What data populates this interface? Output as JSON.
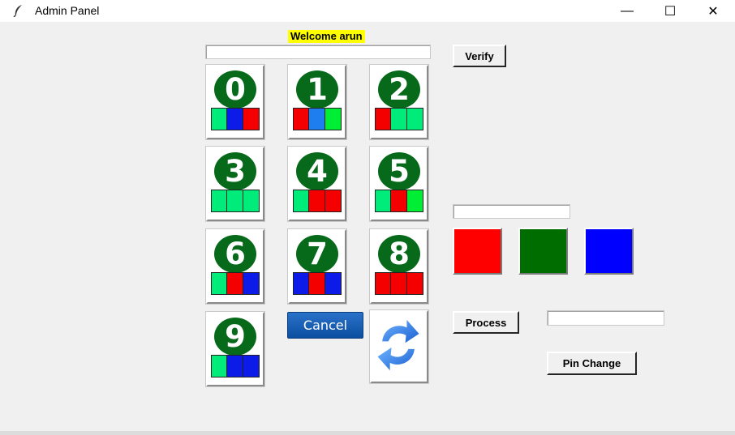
{
  "window": {
    "title": "Admin Panel",
    "icon": "feather-icon",
    "controls": {
      "minimize": "—",
      "maximize": "☐",
      "close": "✕"
    }
  },
  "welcome_text": "Welcome arun",
  "pin_entry_value": "",
  "verify_label": "Verify",
  "keys": [
    {
      "digit": "0",
      "colors": [
        "green",
        "blue",
        "red"
      ]
    },
    {
      "digit": "1",
      "colors": [
        "red",
        "lightblue",
        "lime"
      ]
    },
    {
      "digit": "2",
      "colors": [
        "red",
        "green",
        "green"
      ]
    },
    {
      "digit": "3",
      "colors": [
        "green",
        "green",
        "green"
      ]
    },
    {
      "digit": "4",
      "colors": [
        "green",
        "red",
        "red"
      ]
    },
    {
      "digit": "5",
      "colors": [
        "green",
        "red",
        "lime"
      ]
    },
    {
      "digit": "6",
      "colors": [
        "green",
        "red",
        "blue"
      ]
    },
    {
      "digit": "7",
      "colors": [
        "blue",
        "red",
        "blue"
      ]
    },
    {
      "digit": "8",
      "colors": [
        "red",
        "red",
        "red"
      ]
    },
    {
      "digit": "9",
      "colors": [
        "green",
        "blue",
        "blue"
      ]
    }
  ],
  "cancel_label": "Cancel",
  "refresh_icon": "refresh-icon",
  "color_entry_value": "",
  "swatches": [
    {
      "name": "red",
      "color": "#ff0000"
    },
    {
      "name": "green",
      "color": "#006d00"
    },
    {
      "name": "blue",
      "color": "#0000ff"
    }
  ],
  "process_label": "Process",
  "process_entry_value": "",
  "pin_change_label": "Pin Change"
}
